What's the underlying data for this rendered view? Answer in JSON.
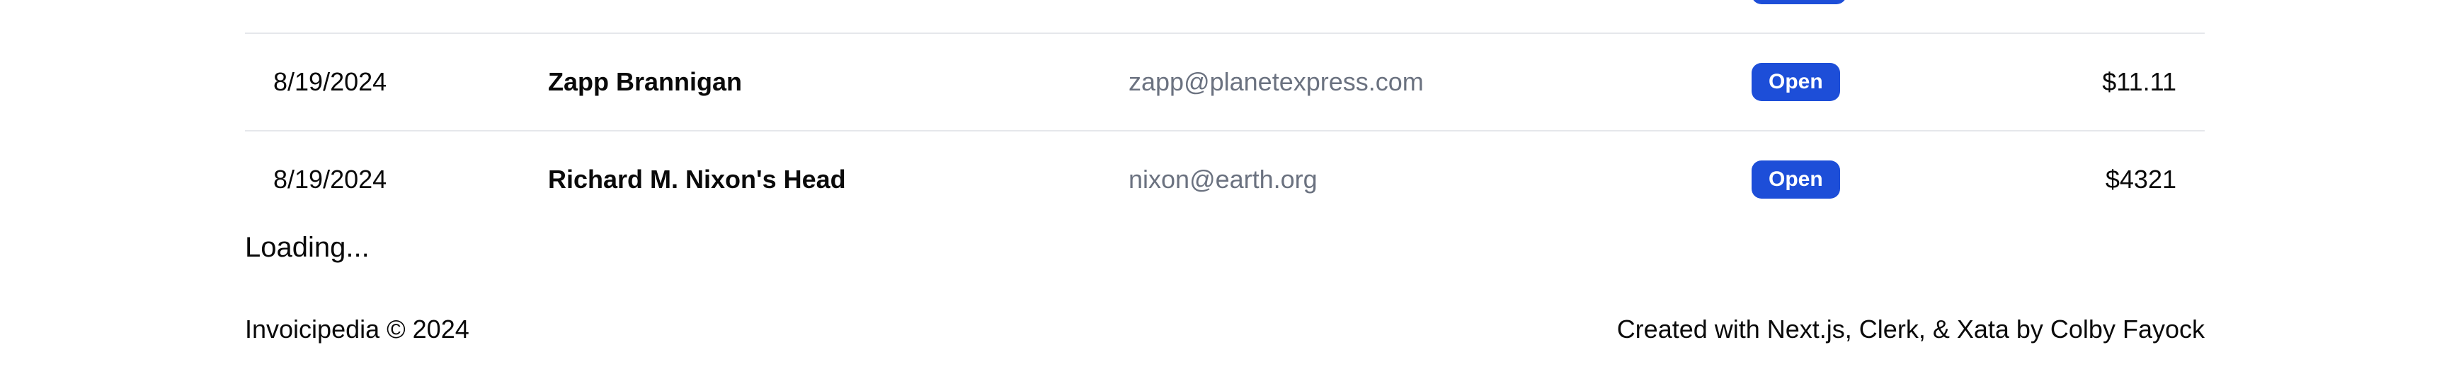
{
  "invoices": {
    "rows": [
      {
        "date": "8/19/2024",
        "name": "Zapp Brannigan",
        "email": "zapp@planetexpress.com",
        "status": "Open",
        "amount": "$11.11"
      },
      {
        "date": "8/19/2024",
        "name": "Richard M. Nixon's Head",
        "email": "nixon@earth.org",
        "status": "Open",
        "amount": "$4321"
      }
    ]
  },
  "loading_text": "Loading...",
  "footer": {
    "copyright": "Invoicipedia © 2024",
    "credits": "Created with Next.js, Clerk, & Xata by Colby Fayock"
  },
  "colors": {
    "status_open": "#1d4ed8",
    "email_text": "#6b7280",
    "divider": "#e5e7eb"
  }
}
